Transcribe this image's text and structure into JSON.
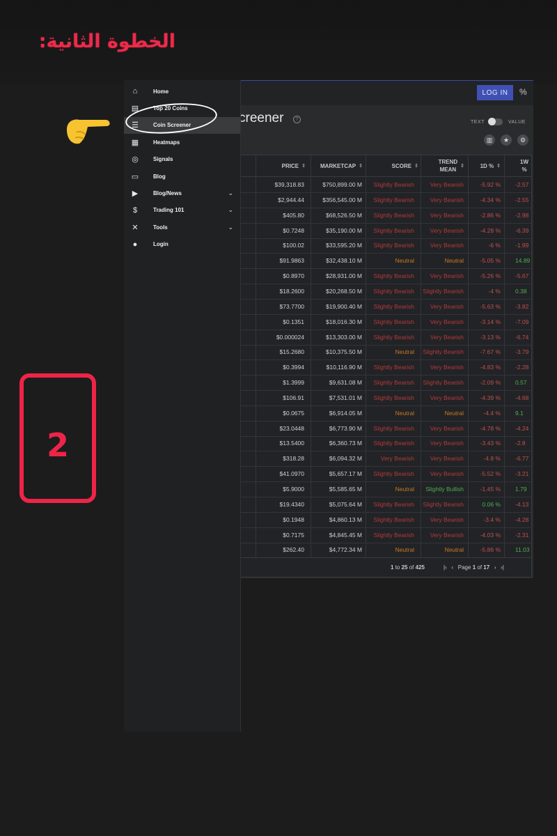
{
  "overlay": {
    "step_title": "الخطوة الثانية:",
    "step_number": "2",
    "accent_color": "#ee2447"
  },
  "app": {
    "login_label": "LOG IN",
    "percent_icon": "percent-icon",
    "page_title": "creener",
    "toggle": {
      "left_label": "TEXT",
      "right_label": "VALUE"
    },
    "toolbar_icons": [
      "columns-icon",
      "star-icon",
      "gear-icon"
    ]
  },
  "sidebar": {
    "items": [
      {
        "label": "Home",
        "icon": "home-icon",
        "expandable": false,
        "active": false
      },
      {
        "label": "Top 20 Coins",
        "icon": "book-icon",
        "expandable": false,
        "active": false
      },
      {
        "label": "Coin Screener",
        "icon": "list-icon",
        "expandable": false,
        "active": true
      },
      {
        "label": "Heatmaps",
        "icon": "heatmap-icon",
        "expandable": false,
        "active": false
      },
      {
        "label": "Signals",
        "icon": "radar-icon",
        "expandable": false,
        "active": false
      },
      {
        "label": "Blog",
        "icon": "blog-icon",
        "expandable": false,
        "active": false
      },
      {
        "label": "Blog/News",
        "icon": "video-icon",
        "expandable": true,
        "active": false
      },
      {
        "label": "Trading 101",
        "icon": "dollar-icon",
        "expandable": true,
        "active": false
      },
      {
        "label": "Tools",
        "icon": "tools-icon",
        "expandable": true,
        "active": false
      },
      {
        "label": "Login",
        "icon": "person-icon",
        "expandable": false,
        "active": false
      }
    ]
  },
  "table": {
    "headers": {
      "price": "PRICE",
      "marketcap": "MARKETCAP",
      "score": "SCORE",
      "trend": "TREND\nMEAN",
      "d1": "1D %",
      "w1": "1W %"
    },
    "rows": [
      {
        "price": "$39,318.83",
        "cap": "$750,899.00 M",
        "score": "Slightly Bearish",
        "trend": "Very Bearish",
        "d1": "-5.92 %",
        "w1": "-2.57"
      },
      {
        "price": "$2,944.44",
        "cap": "$356,545.00 M",
        "score": "Slightly Bearish",
        "trend": "Very Bearish",
        "d1": "-4.34 %",
        "w1": "-2.55"
      },
      {
        "price": "$405.80",
        "cap": "$68,526.50 M",
        "score": "Slightly Bearish",
        "trend": "Very Bearish",
        "d1": "-2.86 %",
        "w1": "-2.98"
      },
      {
        "price": "$0.7248",
        "cap": "$35,190.00 M",
        "score": "Slightly Bearish",
        "trend": "Very Bearish",
        "d1": "-4.28 %",
        "w1": "-6.39"
      },
      {
        "price": "$100.02",
        "cap": "$33,595.20 M",
        "score": "Slightly Bearish",
        "trend": "Very Bearish",
        "d1": "-6 %",
        "w1": "-1.99"
      },
      {
        "price": "$91.9863",
        "cap": "$32,438.10 M",
        "score": "Neutral",
        "trend": "Neutral",
        "d1": "-5.05 %",
        "w1": "14.89"
      },
      {
        "price": "$0.8970",
        "cap": "$28,931.00 M",
        "score": "Slightly Bearish",
        "trend": "Very Bearish",
        "d1": "-5.26 %",
        "w1": "-5.67"
      },
      {
        "price": "$18.2600",
        "cap": "$20,268.50 M",
        "score": "Slightly Bearish",
        "trend": "Slightly Bearish",
        "d1": "-4 %",
        "w1": "0.38"
      },
      {
        "price": "$73.7700",
        "cap": "$19,900.40 M",
        "score": "Slightly Bearish",
        "trend": "Very Bearish",
        "d1": "-5.63 %",
        "w1": "-3.82"
      },
      {
        "price": "$0.1351",
        "cap": "$18,016.30 M",
        "score": "Slightly Bearish",
        "trend": "Very Bearish",
        "d1": "-3.14 %",
        "w1": "-7.09"
      },
      {
        "price": "$0.000024",
        "cap": "$13,303.00 M",
        "score": "Slightly Bearish",
        "trend": "Very Bearish",
        "d1": "-3.13 %",
        "w1": "-6.74"
      },
      {
        "price": "$15.2680",
        "cap": "$10,375.50 M",
        "score": "Neutral",
        "trend": "Slightly Bearish",
        "d1": "-7.67 %",
        "w1": "-3.79"
      },
      {
        "price": "$0.3994",
        "cap": "$10,116.90 M",
        "score": "Slightly Bearish",
        "trend": "Very Bearish",
        "d1": "-4.83 %",
        "w1": "-2.28"
      },
      {
        "price": "$1.3999",
        "cap": "$9,631.08 M",
        "score": "Slightly Bearish",
        "trend": "Slightly Bearish",
        "d1": "-2.09 %",
        "w1": "0.57"
      },
      {
        "price": "$106.91",
        "cap": "$7,531.01 M",
        "score": "Slightly Bearish",
        "trend": "Very Bearish",
        "d1": "-4.39 %",
        "w1": "-4.68"
      },
      {
        "price": "$0.0675",
        "cap": "$6,914.05 M",
        "score": "Neutral",
        "trend": "Neutral",
        "d1": "-4.4 %",
        "w1": "9.1"
      },
      {
        "price": "$23.0448",
        "cap": "$6,773.90 M",
        "score": "Slightly Bearish",
        "trend": "Very Bearish",
        "d1": "-4.78 %",
        "w1": "-4.24"
      },
      {
        "price": "$13.5400",
        "cap": "$6,360.73 M",
        "score": "Slightly Bearish",
        "trend": "Very Bearish",
        "d1": "-3.43 %",
        "w1": "-2.8"
      },
      {
        "price": "$318.28",
        "cap": "$6,094.32 M",
        "score": "Very Bearish",
        "trend": "Very Bearish",
        "d1": "-4.8 %",
        "w1": "-6.77"
      },
      {
        "price": "$41.0970",
        "cap": "$5,657.17 M",
        "score": "Slightly Bearish",
        "trend": "Very Bearish",
        "d1": "-5.52 %",
        "w1": "-3.21"
      },
      {
        "price": "$5.9000",
        "cap": "$5,585.65 M",
        "score": "Neutral",
        "trend": "Slightly Bullish",
        "d1": "-1.45 %",
        "w1": "1.79"
      },
      {
        "price": "$19.4340",
        "cap": "$5,075.64 M",
        "score": "Slightly Bearish",
        "trend": "Slightly Bearish",
        "d1": "0.06 %",
        "w1": "-4.13"
      },
      {
        "price": "$0.1948",
        "cap": "$4,860.13 M",
        "score": "Slightly Bearish",
        "trend": "Very Bearish",
        "d1": "-3.4 %",
        "w1": "-4.28"
      },
      {
        "price": "$0.7175",
        "cap": "$4,845.45 M",
        "score": "Slightly Bearish",
        "trend": "Very Bearish",
        "d1": "-4.03 %",
        "w1": "-2.31"
      },
      {
        "price": "$262.40",
        "cap": "$4,772.34 M",
        "score": "Neutral",
        "trend": "Neutral",
        "d1": "-5.86 %",
        "w1": "11.03"
      }
    ],
    "footer": {
      "range_start": "1",
      "range_to": "to",
      "range_end": "25",
      "range_of": "of",
      "total": "425",
      "page_label": "Page",
      "page": "1",
      "page_of": "of",
      "page_total": "17"
    }
  }
}
